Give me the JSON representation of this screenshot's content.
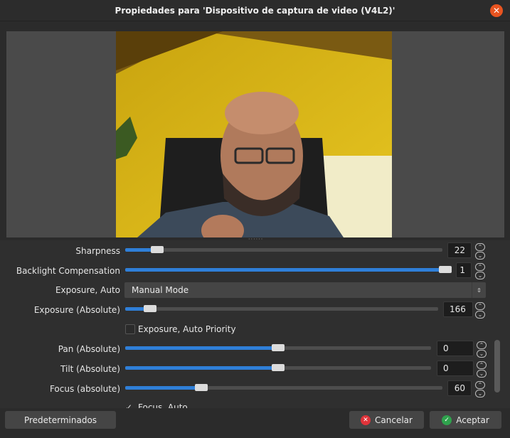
{
  "window": {
    "title": "Propiedades para 'Dispositivo de captura de video (V4L2)'"
  },
  "icons": {
    "close": "close-icon",
    "cancel": "cancel-icon",
    "accept": "check-icon"
  },
  "colors": {
    "accent": "#2f7fd8",
    "close": "#e95420",
    "cancel": "#e0333a",
    "accept": "#2fa24d"
  },
  "controls": {
    "sharpness": {
      "label": "Sharpness",
      "value": "22",
      "fraction": 0.1
    },
    "backlight": {
      "label": "Backlight Compensation",
      "value": "1",
      "fraction": 1.0
    },
    "exposure_auto": {
      "label": "Exposure, Auto",
      "selected": "Manual Mode"
    },
    "exposure_absolute": {
      "label": "Exposure (Absolute)",
      "value": "166",
      "fraction": 0.08
    },
    "exposure_auto_priority": {
      "label": "Exposure, Auto Priority",
      "checked": false
    },
    "pan": {
      "label": "Pan (Absolute)",
      "value": "0",
      "fraction": 0.5
    },
    "tilt": {
      "label": "Tilt (Absolute)",
      "value": "0",
      "fraction": 0.5
    },
    "focus": {
      "label": "Focus (absolute)",
      "value": "60",
      "fraction": 0.24
    },
    "focus_auto": {
      "label": "Focus, Auto",
      "checked": true
    }
  },
  "buttons": {
    "defaults": "Predeterminados",
    "cancel": "Cancelar",
    "accept": "Aceptar"
  }
}
